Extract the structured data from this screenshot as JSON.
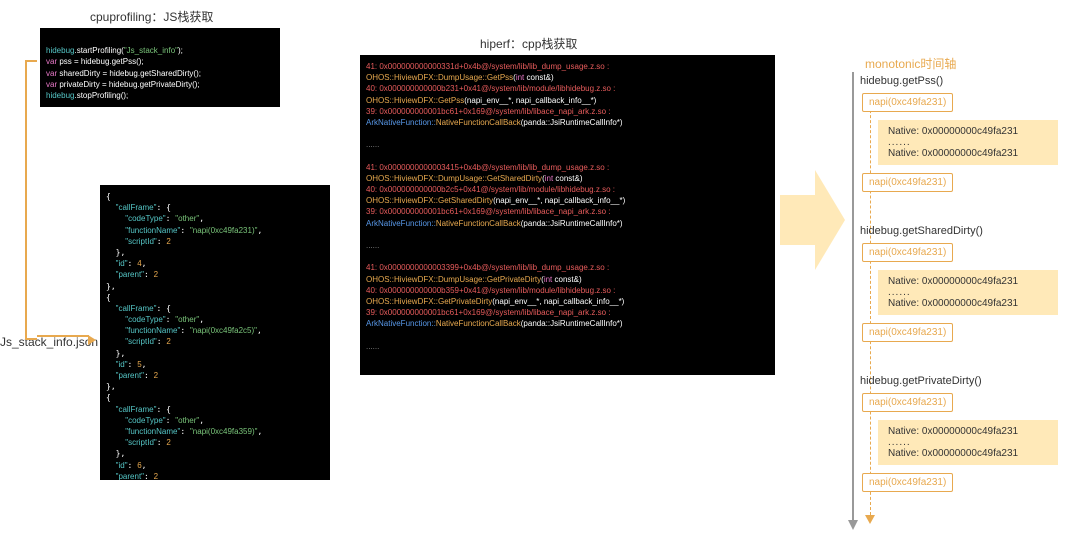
{
  "labels": {
    "cpuprofiling": "cpuprofiling：JS栈获取",
    "hiperf": "hiperf：cpp栈获取",
    "jsonfile": "Js_stack_info.json",
    "monotonic": "monotonic时间轴"
  },
  "jsbox": {
    "l1": [
      "hidebug",
      ".startProfiling(",
      "\"Js_stack_info\"",
      ");"
    ],
    "l2": [
      "var",
      " pss = hidebug.getPss();"
    ],
    "l3": [
      "var",
      " sharedDirty = hidebug.getSharedDirty();"
    ],
    "l4": [
      "var",
      " privateDirty = hidebug.getPrivateDirty();"
    ],
    "l5": [
      "hidebug",
      ".stopProfiling();"
    ]
  },
  "jsonbox": {
    "frames": [
      {
        "fn": "napi(0xc49fa231)",
        "id": "4",
        "parent": "2"
      },
      {
        "fn": "napi(0xc49fa2c5)",
        "id": "5",
        "parent": "2"
      },
      {
        "fn": "napi(0xc49fa359)",
        "id": "6",
        "parent": "2"
      }
    ],
    "codeType": "other",
    "scriptId": "2"
  },
  "cppbox": {
    "blocks": [
      {
        "hdr": "41: 0x000000000000331d+0x4b@/system/lib/lib_dump_usage.z.so :",
        "call1": [
          "OHOS::HiviewDFX::DumpUsage::GetPss",
          "(",
          "int",
          " const&)"
        ],
        "mod": "40: 0x000000000000b231+0x41@/system/lib/module/libhidebug.z.so :",
        "call2": [
          "OHOS::HiviewDFX::GetPss",
          "(napi_env__*, napi_callback_info__*)"
        ],
        "ark": "39: 0x000000000001bc61+0x169@/system/lib/libace_napi_ark.z.so :",
        "nfc": [
          "ArkNativeFunction::",
          "NativeFunctionCallBack",
          "(panda::JsiRuntimeCallInfo*)"
        ]
      },
      {
        "hdr": "41: 0x0000000000003415+0x4b@/system/lib/lib_dump_usage.z.so :",
        "call1": [
          "OHOS::HiviewDFX::DumpUsage::GetSharedDirty",
          "(",
          "int",
          " const&)"
        ],
        "mod": "40: 0x000000000000b2c5+0x41@/system/lib/module/libhidebug.z.so :",
        "call2": [
          "OHOS::HiviewDFX::GetSharedDirty",
          "(napi_env__*, napi_callback_info__*)"
        ],
        "ark": "39: 0x000000000001bc61+0x169@/system/lib/libace_napi_ark.z.so :",
        "nfc": [
          "ArkNativeFunction::",
          "NativeFunctionCallBack",
          "(panda::JsiRuntimeCallInfo*)"
        ]
      },
      {
        "hdr": "41: 0x0000000000003399+0x4b@/system/lib/lib_dump_usage.z.so :",
        "call1": [
          "OHOS::HiviewDFX::DumpUsage::GetPrivateDirty",
          "(",
          "int",
          " const&)"
        ],
        "mod": "40: 0x000000000000b359+0x41@/system/lib/module/libhidebug.z.so :",
        "call2": [
          "OHOS::HiviewDFX::GetPrivateDirty",
          "(napi_env__*, napi_callback_info__*)"
        ],
        "ark": "39: 0x000000000001bc61+0x169@/system/lib/libace_napi_ark.z.so :",
        "nfc": [
          "ArkNativeFunction::",
          "NativeFunctionCallBack",
          "(panda::JsiRuntimeCallInfo*)"
        ]
      }
    ],
    "dots": "......"
  },
  "timeline": {
    "methods": [
      "hidebug.getPss()",
      "hidebug.getSharedDirty()",
      "hidebug.getPrivateDirty()"
    ],
    "napi": "napi(0xc49fa231)",
    "native": "Native: 0x00000000c49fa231",
    "dots": "......"
  }
}
